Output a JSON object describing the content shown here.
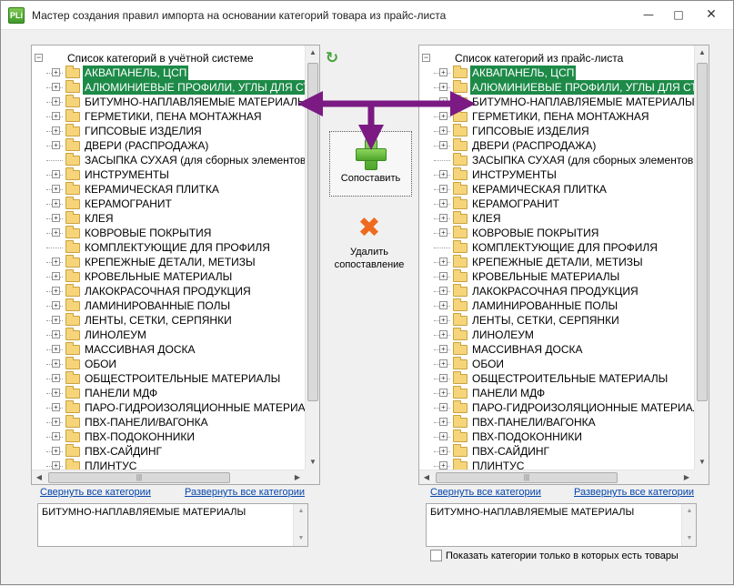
{
  "window": {
    "title": "Мастер создания правил импорта на основании категорий товара из прайс-листа",
    "icon_text": "PLi",
    "min_glyph": "—",
    "max_glyph": "□",
    "close_glyph": "✕"
  },
  "left_tree": {
    "root_label": "Список категорий в учётной системе",
    "items": [
      {
        "label": "АКВАПАНЕЛЬ, ЦСП",
        "selected": true,
        "expandable": true
      },
      {
        "label": "АЛЮМИНИЕВЫЕ ПРОФИЛИ,  УГЛЫ ДЛЯ СТУ",
        "selected": true,
        "expandable": true
      },
      {
        "label": "БИТУМНО-НАПЛАВЛЯЕМЫЕ МАТЕРИАЛЫ",
        "selected": false,
        "expandable": true
      },
      {
        "label": "ГЕРМЕТИКИ, ПЕНА МОНТАЖНАЯ",
        "selected": false,
        "expandable": true
      },
      {
        "label": "ГИПСОВЫЕ ИЗДЕЛИЯ",
        "selected": false,
        "expandable": true
      },
      {
        "label": "ДВЕРИ (РАСПРОДАЖА)",
        "selected": false,
        "expandable": true
      },
      {
        "label": "ЗАСЫПКА СУХАЯ  (для сборных элементов",
        "selected": false,
        "expandable": false
      },
      {
        "label": "ИНСТРУМЕНТЫ",
        "selected": false,
        "expandable": true
      },
      {
        "label": "КЕРАМИЧЕСКАЯ ПЛИТКА",
        "selected": false,
        "expandable": true
      },
      {
        "label": "КЕРАМОГРАНИТ",
        "selected": false,
        "expandable": true
      },
      {
        "label": "КЛЕЯ",
        "selected": false,
        "expandable": true
      },
      {
        "label": "КОВРОВЫЕ ПОКРЫТИЯ",
        "selected": false,
        "expandable": true
      },
      {
        "label": "КОМПЛЕКТУЮЩИЕ ДЛЯ ПРОФИЛЯ",
        "selected": false,
        "expandable": false
      },
      {
        "label": "КРЕПЕЖНЫЕ ДЕТАЛИ, МЕТИЗЫ",
        "selected": false,
        "expandable": true
      },
      {
        "label": "КРОВЕЛЬНЫЕ МАТЕРИАЛЫ",
        "selected": false,
        "expandable": true
      },
      {
        "label": "ЛАКОКРАСОЧНАЯ ПРОДУКЦИЯ",
        "selected": false,
        "expandable": true
      },
      {
        "label": "ЛАМИНИРОВАННЫЕ ПОЛЫ",
        "selected": false,
        "expandable": true
      },
      {
        "label": "ЛЕНТЫ, СЕТКИ, СЕРПЯНКИ",
        "selected": false,
        "expandable": true
      },
      {
        "label": "ЛИНОЛЕУМ",
        "selected": false,
        "expandable": true
      },
      {
        "label": "МАССИВНАЯ ДОСКА",
        "selected": false,
        "expandable": true
      },
      {
        "label": "ОБОИ",
        "selected": false,
        "expandable": true
      },
      {
        "label": "ОБЩЕСТРОИТЕЛЬНЫЕ МАТЕРИАЛЫ",
        "selected": false,
        "expandable": true
      },
      {
        "label": "ПАНЕЛИ МДФ",
        "selected": false,
        "expandable": true
      },
      {
        "label": "ПАРО-ГИДРОИЗОЛЯЦИОННЫЕ МАТЕРИАЛЫ",
        "selected": false,
        "expandable": true
      },
      {
        "label": "ПВХ-ПАНЕЛИ/ВАГОНКА",
        "selected": false,
        "expandable": true
      },
      {
        "label": "ПВХ-ПОДОКОННИКИ",
        "selected": false,
        "expandable": true
      },
      {
        "label": "ПВХ-САЙДИНГ",
        "selected": false,
        "expandable": true
      },
      {
        "label": "ПЛИНТУС",
        "selected": false,
        "expandable": true
      }
    ],
    "collapse_all_label": "Свернуть все категории",
    "expand_all_label": "Развернуть все категории",
    "memo_text": "БИТУМНО-НАПЛАВЛЯЕМЫЕ МАТЕРИАЛЫ"
  },
  "right_tree": {
    "root_label": "Список категорий из прайс-листа",
    "items": [
      {
        "label": "АКВАПАНЕЛЬ, ЦСП",
        "selected": true,
        "expandable": true
      },
      {
        "label": "АЛЮМИНИЕВЫЕ ПРОФИЛИ,  УГЛЫ ДЛЯ СТУ",
        "selected": true,
        "expandable": true
      },
      {
        "label": "БИТУМНО-НАПЛАВЛЯЕМЫЕ МАТЕРИАЛЫ",
        "selected": false,
        "expandable": true
      },
      {
        "label": "ГЕРМЕТИКИ, ПЕНА МОНТАЖНАЯ",
        "selected": false,
        "expandable": true
      },
      {
        "label": "ГИПСОВЫЕ ИЗДЕЛИЯ",
        "selected": false,
        "expandable": true
      },
      {
        "label": "ДВЕРИ (РАСПРОДАЖА)",
        "selected": false,
        "expandable": true
      },
      {
        "label": "ЗАСЫПКА СУХАЯ  (для сборных элементов",
        "selected": false,
        "expandable": false
      },
      {
        "label": "ИНСТРУМЕНТЫ",
        "selected": false,
        "expandable": true
      },
      {
        "label": "КЕРАМИЧЕСКАЯ ПЛИТКА",
        "selected": false,
        "expandable": true
      },
      {
        "label": "КЕРАМОГРАНИТ",
        "selected": false,
        "expandable": true
      },
      {
        "label": "КЛЕЯ",
        "selected": false,
        "expandable": true
      },
      {
        "label": "КОВРОВЫЕ ПОКРЫТИЯ",
        "selected": false,
        "expandable": true
      },
      {
        "label": "КОМПЛЕКТУЮЩИЕ ДЛЯ ПРОФИЛЯ",
        "selected": false,
        "expandable": false
      },
      {
        "label": "КРЕПЕЖНЫЕ ДЕТАЛИ, МЕТИЗЫ",
        "selected": false,
        "expandable": true
      },
      {
        "label": "КРОВЕЛЬНЫЕ МАТЕРИАЛЫ",
        "selected": false,
        "expandable": true
      },
      {
        "label": "ЛАКОКРАСОЧНАЯ ПРОДУКЦИЯ",
        "selected": false,
        "expandable": true
      },
      {
        "label": "ЛАМИНИРОВАННЫЕ ПОЛЫ",
        "selected": false,
        "expandable": true
      },
      {
        "label": "ЛЕНТЫ, СЕТКИ, СЕРПЯНКИ",
        "selected": false,
        "expandable": true
      },
      {
        "label": "ЛИНОЛЕУМ",
        "selected": false,
        "expandable": true
      },
      {
        "label": "МАССИВНАЯ ДОСКА",
        "selected": false,
        "expandable": true
      },
      {
        "label": "ОБОИ",
        "selected": false,
        "expandable": true
      },
      {
        "label": "ОБЩЕСТРОИТЕЛЬНЫЕ МАТЕРИАЛЫ",
        "selected": false,
        "expandable": true
      },
      {
        "label": "ПАНЕЛИ МДФ",
        "selected": false,
        "expandable": true
      },
      {
        "label": "ПАРО-ГИДРОИЗОЛЯЦИОННЫЕ МАТЕРИАЛЫ",
        "selected": false,
        "expandable": true
      },
      {
        "label": "ПВХ-ПАНЕЛИ/ВАГОНКА",
        "selected": false,
        "expandable": true
      },
      {
        "label": "ПВХ-ПОДОКОННИКИ",
        "selected": false,
        "expandable": true
      },
      {
        "label": "ПВХ-САЙДИНГ",
        "selected": false,
        "expandable": true
      },
      {
        "label": "ПЛИНТУС",
        "selected": false,
        "expandable": true
      }
    ],
    "collapse_all_label": "Свернуть все категории",
    "expand_all_label": "Развернуть все категории",
    "memo_text": "БИТУМНО-НАПЛАВЛЯЕМЫЕ МАТЕРИАЛЫ",
    "filter_checkbox_label": "Показать категории только в которых есть товары",
    "filter_checked": false
  },
  "actions": {
    "refresh_glyph": "↻",
    "match_label": "Сопоставить",
    "delete_label": "Удалить сопоставление",
    "delete_glyph": "✖"
  },
  "glyphs": {
    "expander": "+",
    "collapse": "−",
    "scroll_up": "▲",
    "scroll_down": "▼",
    "scroll_left": "◀",
    "scroll_right": "▶",
    "thumb_grip": "|||"
  },
  "colors": {
    "selection": "#1d8a48",
    "annotation_arrows": "#7a1a82",
    "link": "#0645ad"
  }
}
